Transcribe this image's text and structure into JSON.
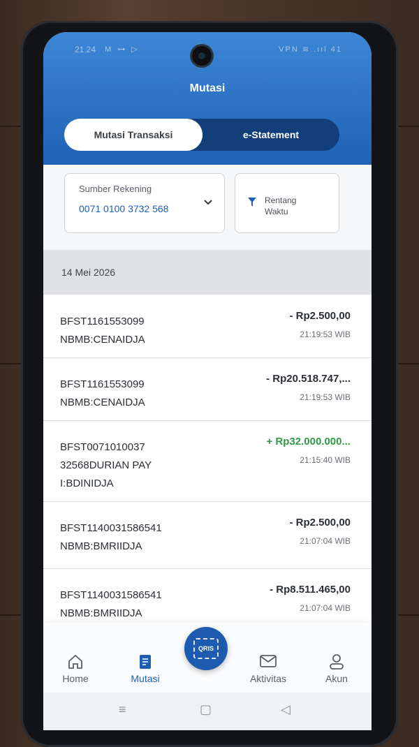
{
  "status_bar": {
    "time": "21.24",
    "left_icons": "M ⊶ ▷",
    "right_icons": "VPN ≋ .ııl 41"
  },
  "header": {
    "title": "Mutasi",
    "tabs": [
      {
        "label": "Mutasi Transaksi",
        "active": true
      },
      {
        "label": "e-Statement",
        "active": false
      }
    ]
  },
  "filters": {
    "source_label": "Sumber Rekening",
    "source_value": "0071 0100 3732 568",
    "range_label": "Rentang Waktu"
  },
  "date_header": "14 Mei 2026",
  "transactions": [
    {
      "desc": "BFST1161553099 NBMB:CENAIDJA",
      "amount": "- Rp2.500,00",
      "time": "21:19:53 WIB",
      "type": "debit"
    },
    {
      "desc": "BFST1161553099 NBMB:CENAIDJA",
      "amount": "- Rp20.518.747,...",
      "time": "21:19:53 WIB",
      "type": "debit"
    },
    {
      "desc": "BFST0071010037 32568DURIAN PAY I:BDINIDJA",
      "amount": "+ Rp32.000.000...",
      "time": "21:15:40 WIB",
      "type": "credit"
    },
    {
      "desc": "BFST1140031586541 NBMB:BMRIIDJA",
      "amount": "- Rp2.500,00",
      "time": "21:07:04 WIB",
      "type": "debit"
    },
    {
      "desc": "BFST1140031586541 NBMB:BMRIIDJA",
      "amount": "- Rp8.511.465,00",
      "time": "21:07:04 WIB",
      "type": "debit"
    }
  ],
  "nav": {
    "home": "Home",
    "mutasi": "Mutasi",
    "qris": "QRIS",
    "aktivitas": "Aktivitas",
    "akun": "Akun"
  },
  "colors": {
    "primary": "#1e5fb4",
    "header": "#3e86d6",
    "credit": "#2e9b48"
  }
}
